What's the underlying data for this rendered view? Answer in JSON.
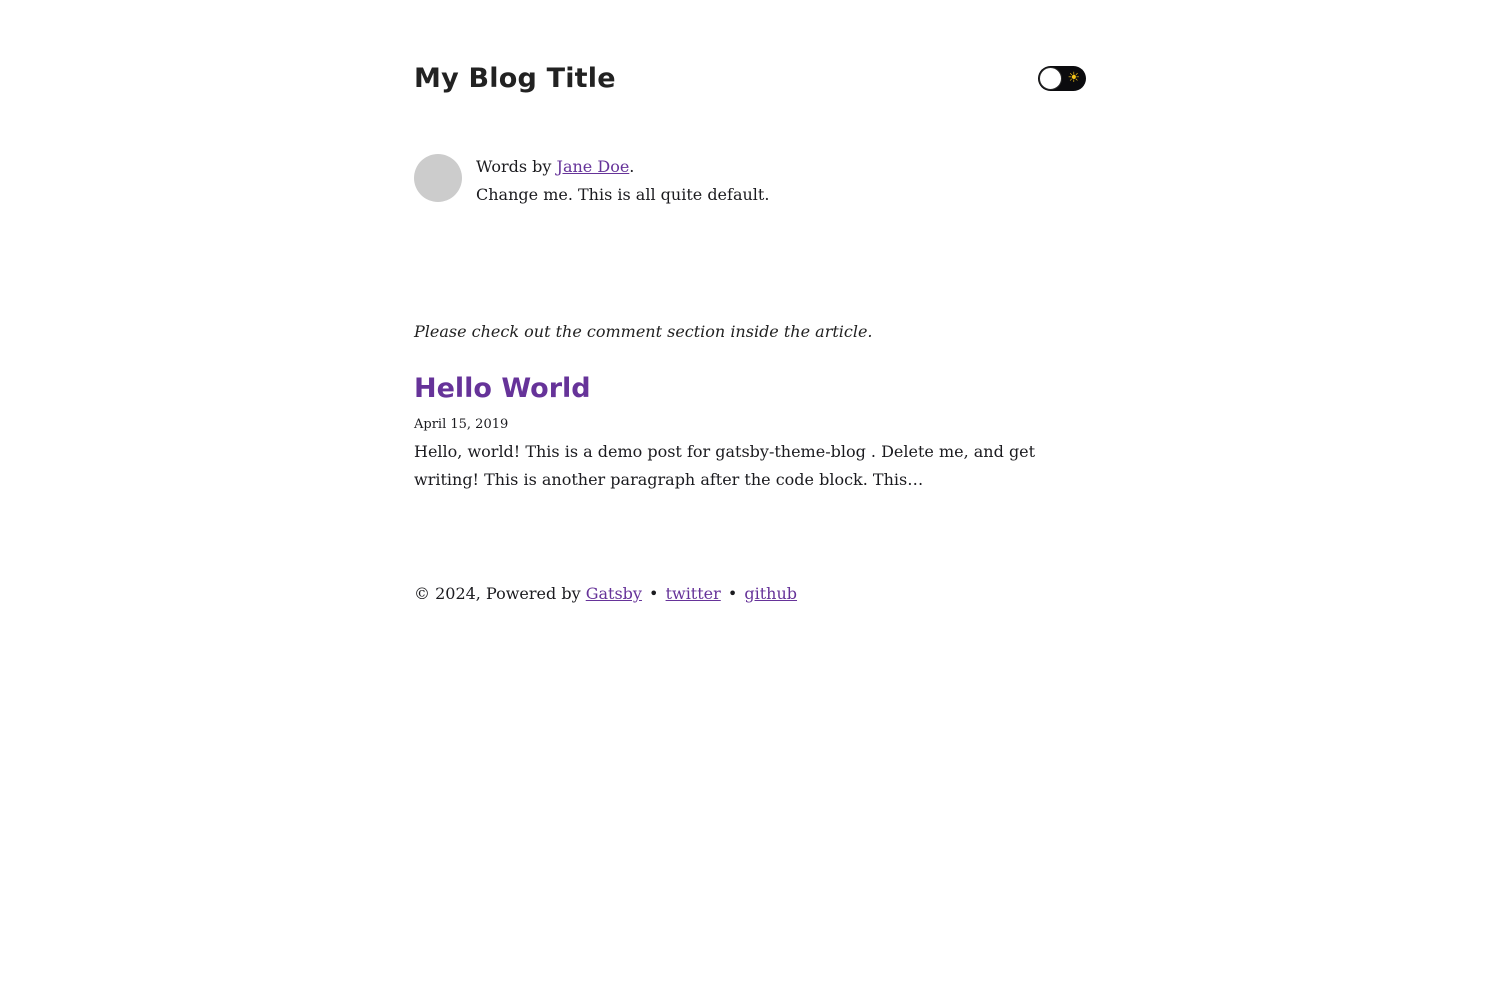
{
  "header": {
    "title": "My Blog Title",
    "theme_toggle_icon": "sun-icon",
    "sun_glyph": "☀"
  },
  "bio": {
    "prefix": "Words by ",
    "author": "Jane Doe",
    "suffix": ".",
    "description": "Change me. This is all quite default."
  },
  "notice": "Please check out the comment section inside the article.",
  "posts": [
    {
      "title": "Hello World",
      "date": "April 15, 2019",
      "excerpt": "Hello, world! This is a demo post for gatsby-theme-blog . Delete me, and get writing! This is another paragraph after the code block. This…"
    }
  ],
  "footer": {
    "copyright": "© 2024, Powered by ",
    "gatsby_link": "Gatsby",
    "separator": " • ",
    "twitter_link": "twitter",
    "github_link": "github"
  },
  "colors": {
    "accent": "#663399",
    "avatar": "#cccccc",
    "toggle_bg": "#0b0b0e"
  }
}
